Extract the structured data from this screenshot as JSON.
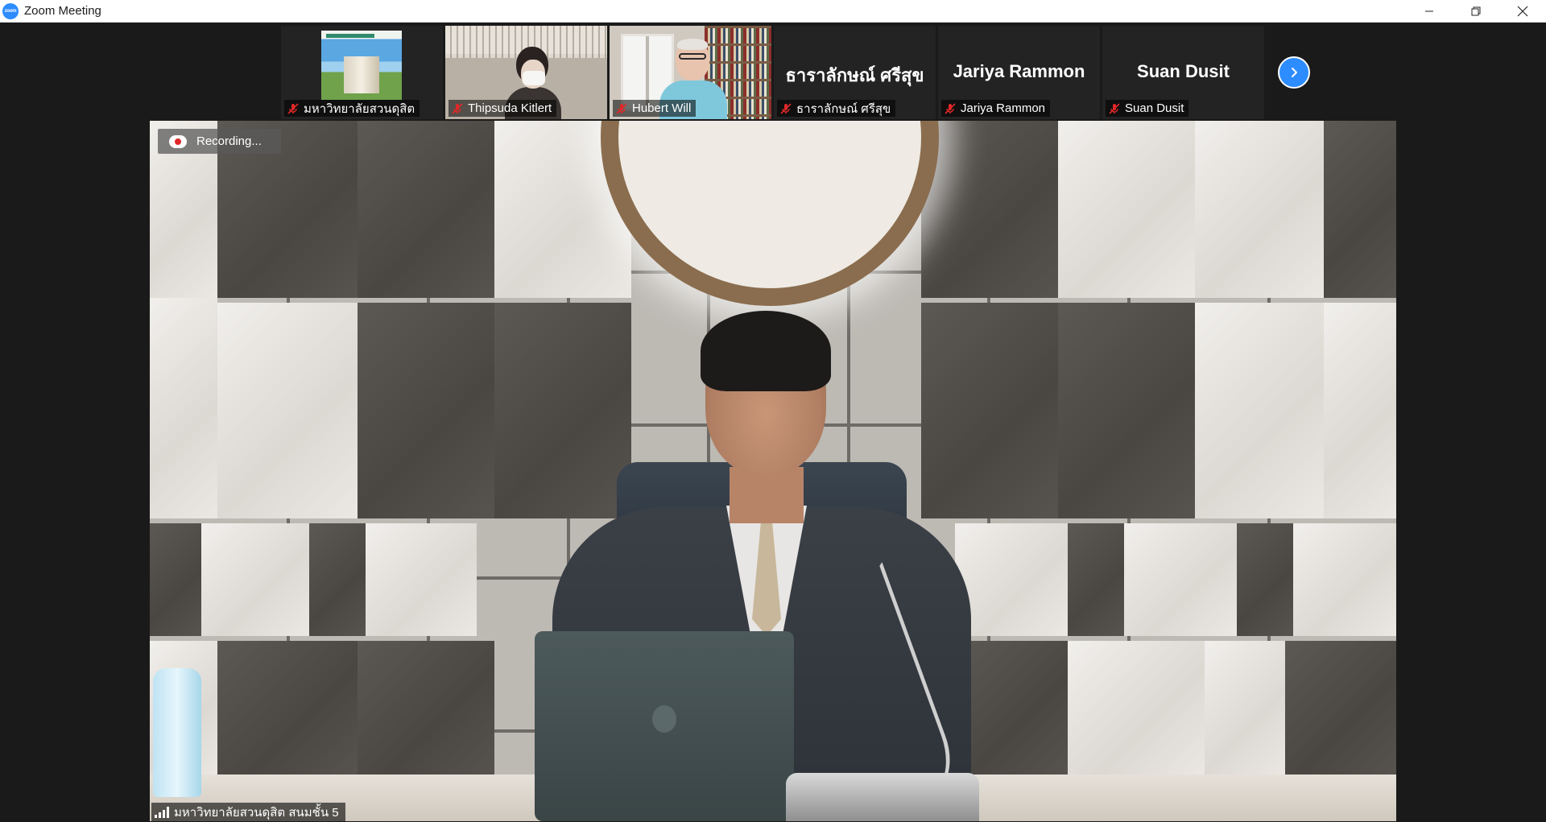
{
  "window": {
    "app_logo_text": "zoom",
    "title": "Zoom Meeting",
    "controls": [
      "minimize",
      "restore",
      "close"
    ]
  },
  "participants": [
    {
      "name": "มหาวิทยาลัยสวนดุสิต",
      "muted": true,
      "video": "poster"
    },
    {
      "name": "Thipsuda Kitlert",
      "muted": true,
      "video": "camera"
    },
    {
      "name": "Hubert Will",
      "muted": true,
      "video": "camera"
    },
    {
      "name": "ธาราลักษณ์ ศรีสุข",
      "muted": true,
      "video": "off",
      "display_name": "ธาราลักษณ์ ศรีสุข"
    },
    {
      "name": "Jariya Rammon",
      "muted": true,
      "video": "off",
      "display_name": "Jariya Rammon"
    },
    {
      "name": "Suan Dusit",
      "muted": true,
      "video": "off",
      "display_name": "Suan Dusit"
    }
  ],
  "strip": {
    "next_icon": "chevron-right-icon"
  },
  "recording": {
    "label": "Recording..."
  },
  "active_speaker": {
    "label": "มหาวิทยาลัยสวนดุสิต สนมชั้น 5"
  },
  "colors": {
    "accent": "#2d8cff",
    "muted_mic": "#e02828",
    "titlebar": "#ffffff",
    "background": "#1a1a1a"
  }
}
